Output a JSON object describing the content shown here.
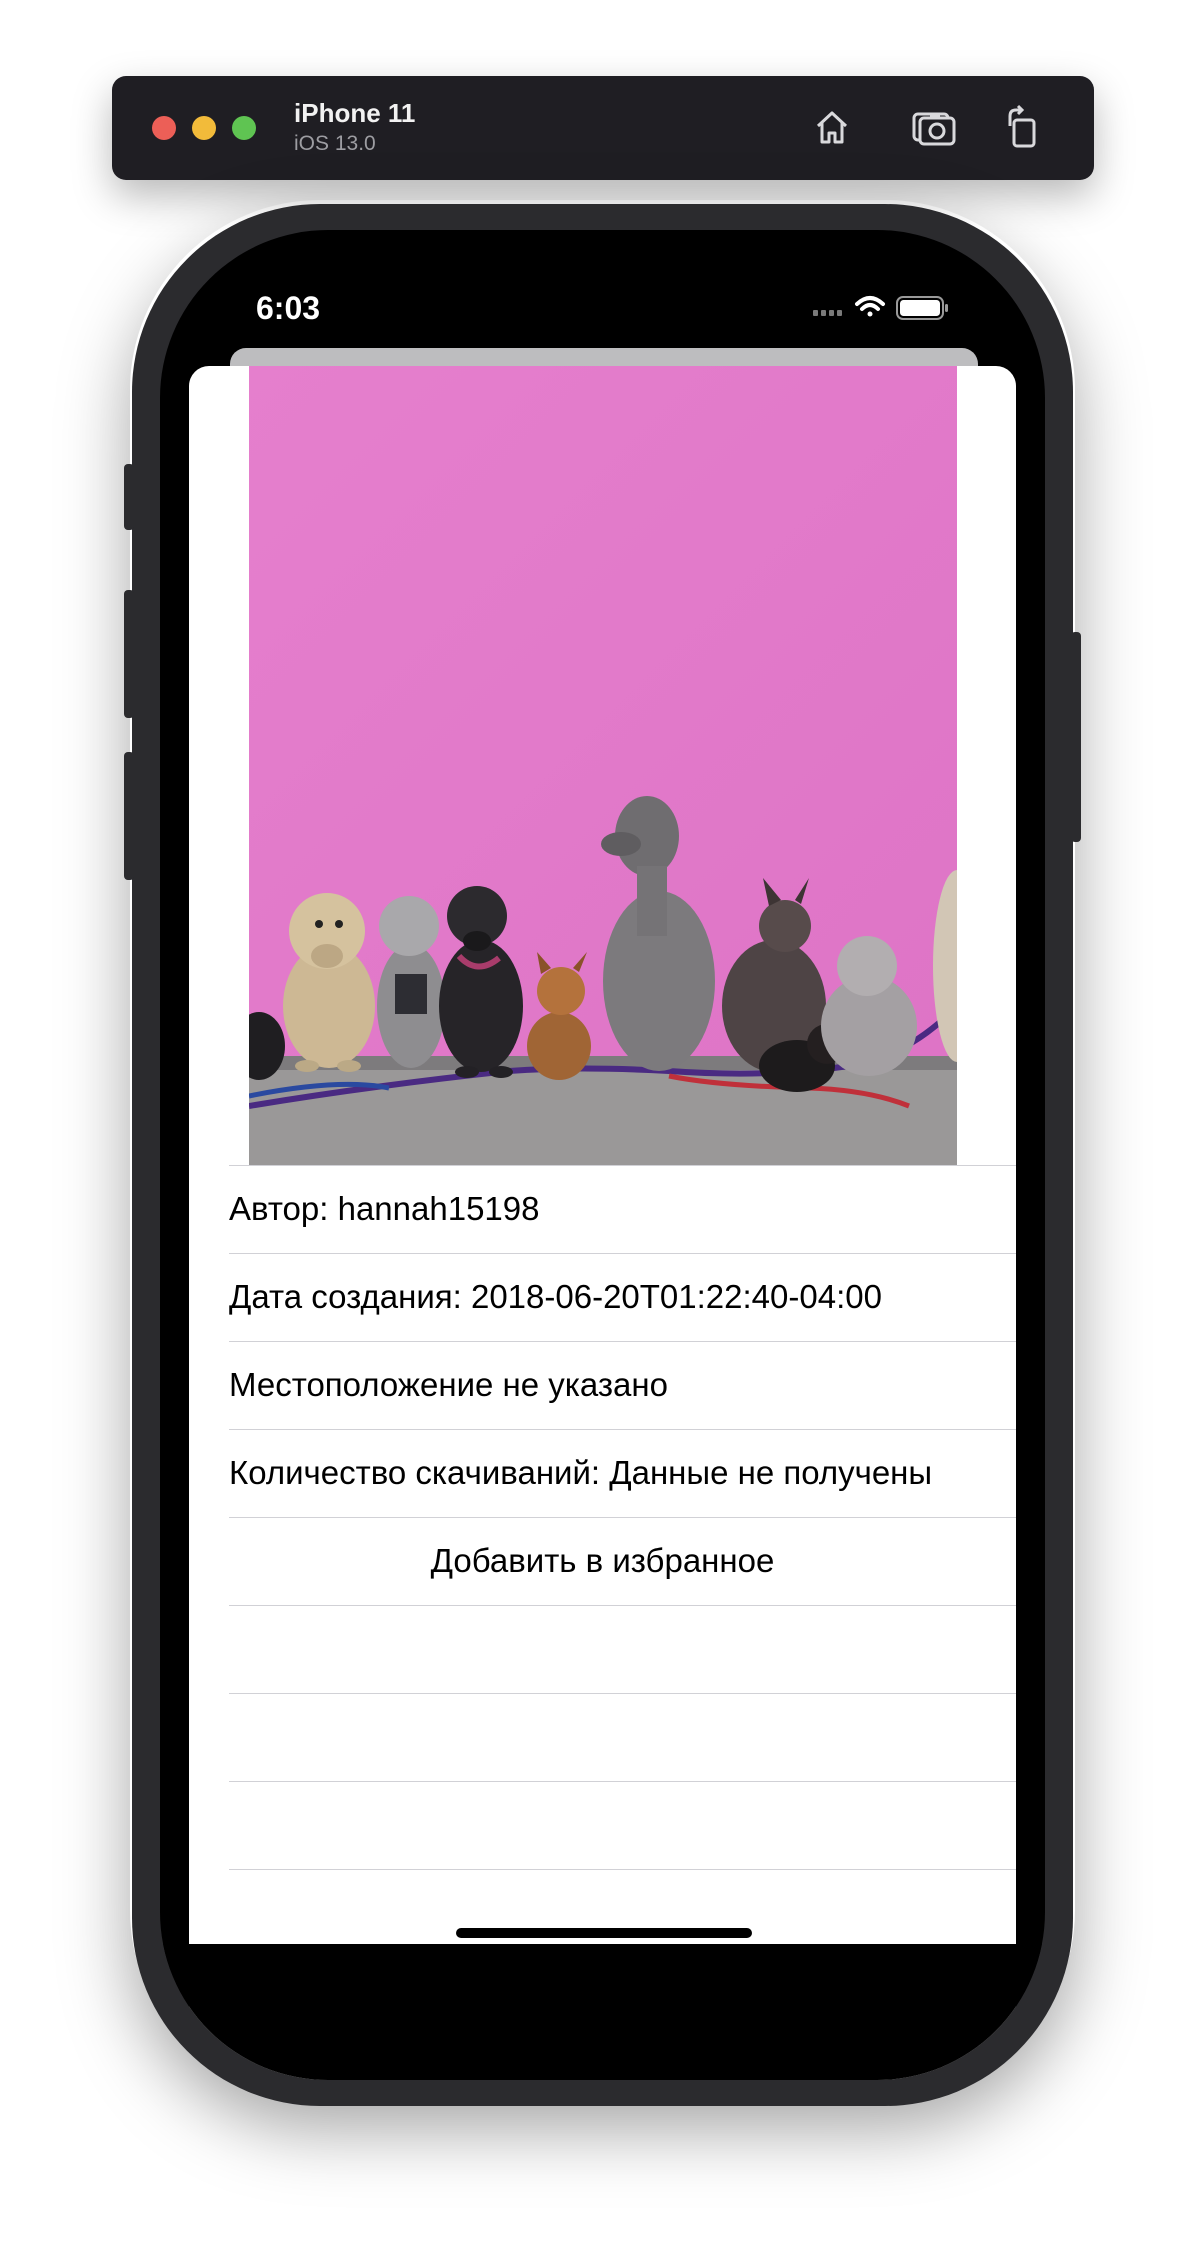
{
  "simulator": {
    "device_name": "iPhone 11",
    "os_version": "iOS 13.0",
    "icons": [
      "home-icon",
      "screenshot-icon",
      "rotate-icon"
    ]
  },
  "status_bar": {
    "time": "6:03",
    "icons": [
      "cellular-icon",
      "wifi-icon",
      "battery-icon"
    ]
  },
  "detail": {
    "photo_description_icon": "dogs-photo",
    "rows": [
      {
        "label": "Автор: hannah15198"
      },
      {
        "label": "Дата создания: 2018-06-20T01:22:40-04:00"
      },
      {
        "label": "Местоположение не указано"
      },
      {
        "label": "Количество скачиваний: Данные не получены"
      }
    ],
    "favorite_button": "Добавить в избранное"
  },
  "colors": {
    "wall_pink": "#e57fcd",
    "separator": "#d1d1d6"
  }
}
